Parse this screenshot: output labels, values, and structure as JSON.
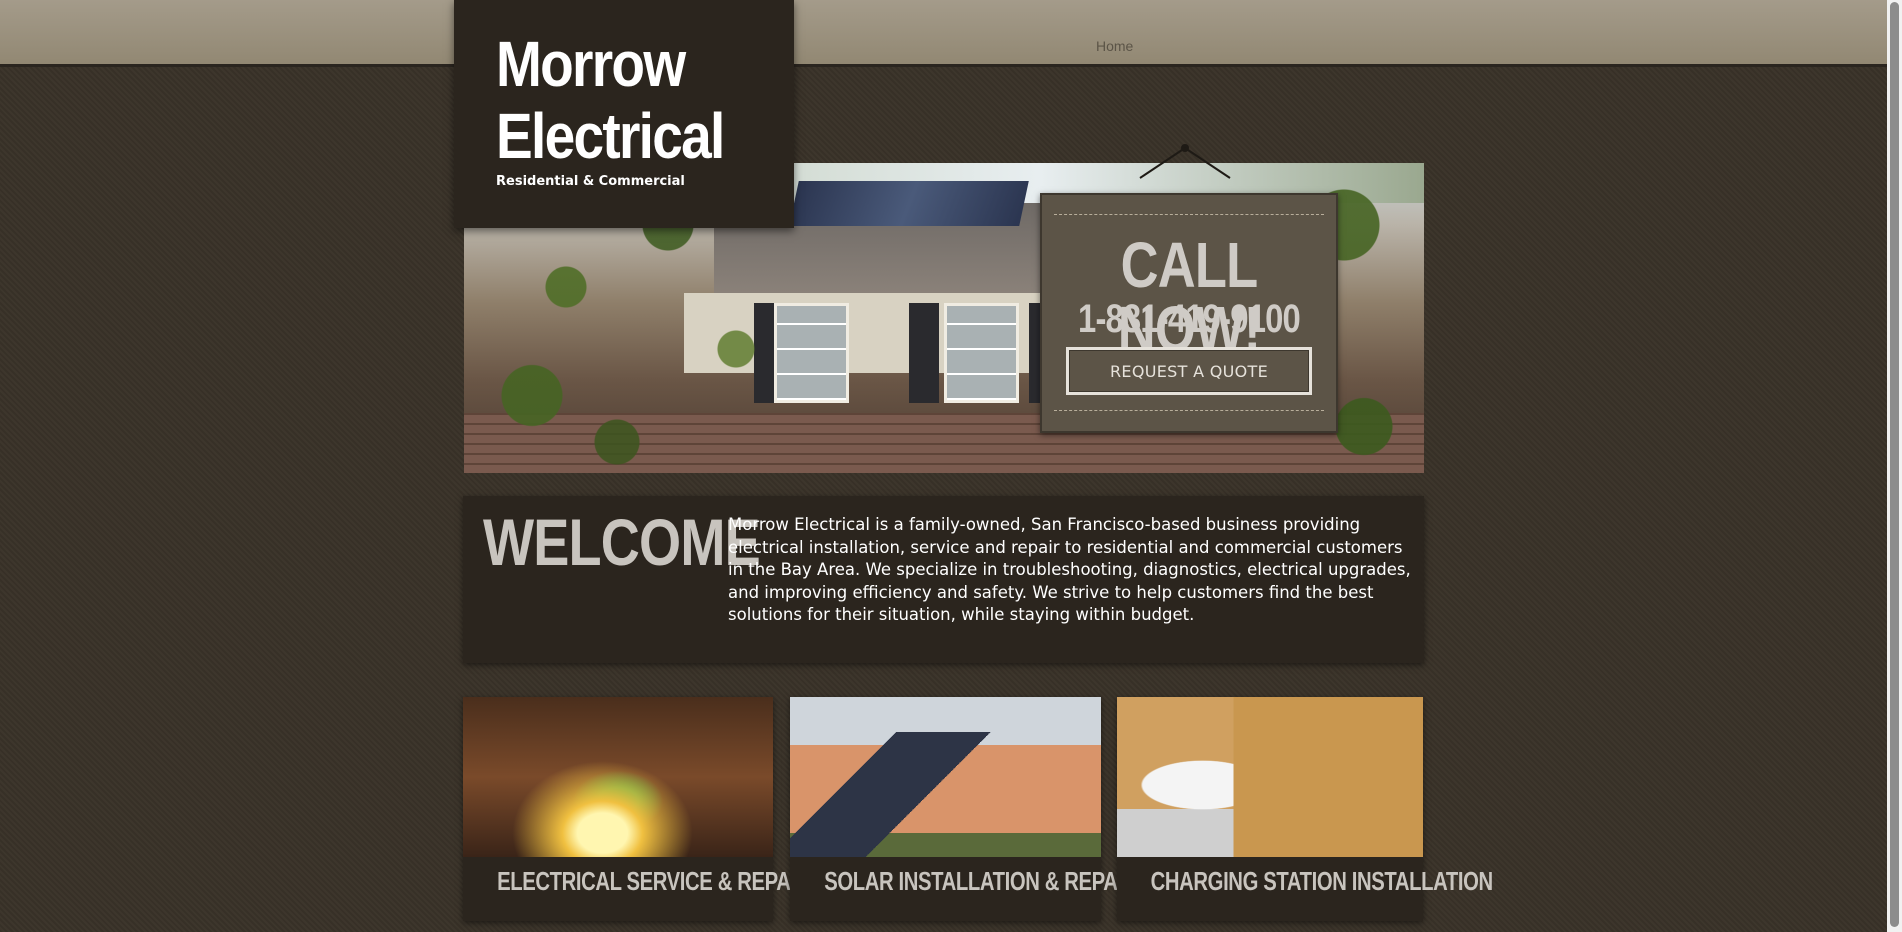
{
  "nav": {
    "home": "Home"
  },
  "brand": {
    "title_line1": "Morrow",
    "title_line2": "Electrical",
    "tagline": "Residential & Commercial"
  },
  "cta": {
    "title": "CALL NOW!",
    "phone": "1-831-419-9100",
    "button": "REQUEST A QUOTE"
  },
  "welcome": {
    "heading": "WELCOME",
    "body": "Morrow Electrical is a family-owned, San Francisco-based business providing electrical installation, service and repair to residential and commercial customers in the Bay Area. We specialize in troubleshooting, diagnostics, electrical upgrades, and improving efficiency and safety. We strive to help customers find the best solutions for their situation, while staying within budget."
  },
  "services": [
    {
      "label": "ELECTRICAL SERVICE & REPAIR"
    },
    {
      "label": "SOLAR INSTALLATION & REPAIR"
    },
    {
      "label": "CHARGING STATION INSTALLATION"
    }
  ],
  "colors": {
    "background": "#3a3329",
    "panel": "#2b251e",
    "topbar": "#978d7b",
    "cta_panel": "#5c5447"
  }
}
